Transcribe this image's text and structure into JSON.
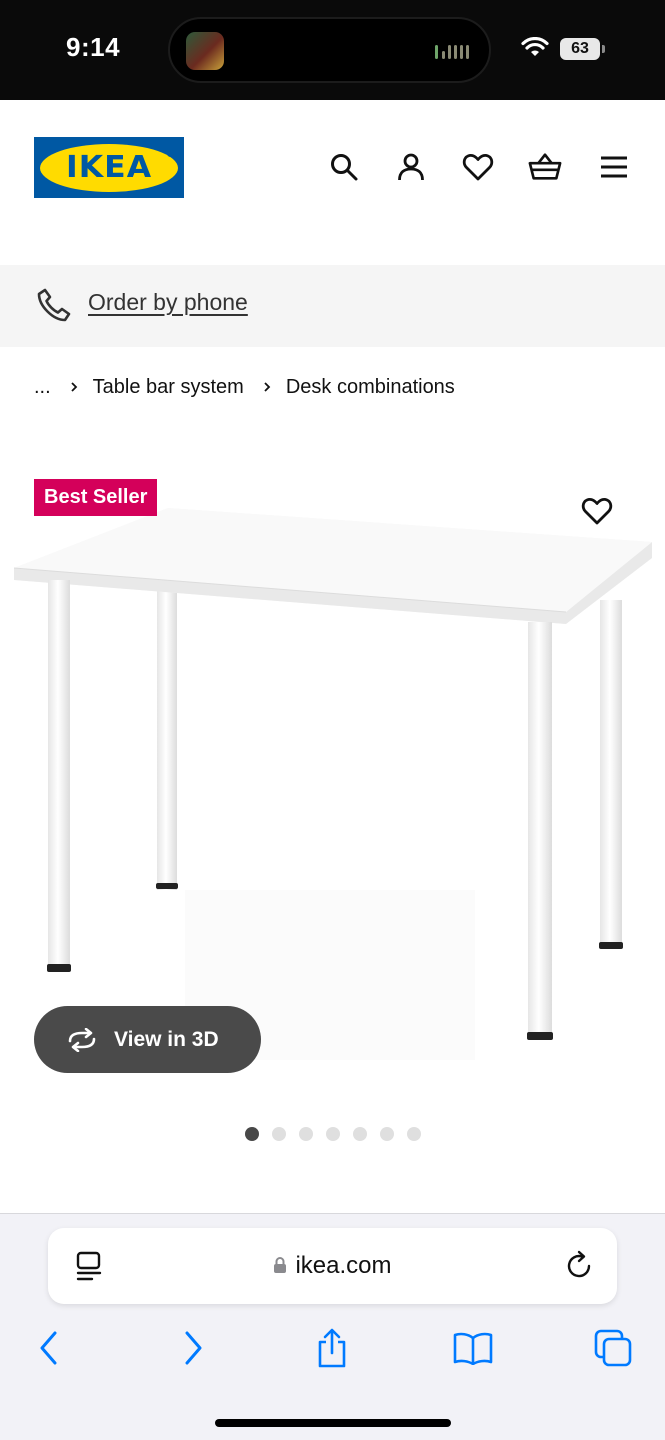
{
  "status_bar": {
    "time": "9:14",
    "battery": "63",
    "icons": [
      "now-playing-art-icon",
      "audio-waveform-icon",
      "wifi-icon",
      "battery-icon"
    ]
  },
  "header": {
    "logo_text": "IKEA",
    "icons": [
      "search-icon",
      "account-icon",
      "favourites-icon",
      "basket-icon",
      "menu-icon"
    ]
  },
  "order_bar": {
    "label": "Order by phone",
    "icon": "phone-icon"
  },
  "breadcrumb": {
    "ellipsis": "...",
    "items": [
      "Table bar system",
      "Desk combinations"
    ]
  },
  "product": {
    "badge": "Best Seller",
    "badge_color": "#d4005a",
    "view_3d_label": "View in 3D",
    "image_count": 7,
    "active_image_index": 0
  },
  "browser": {
    "url": "ikea.com",
    "toolbar": [
      "back-icon",
      "forward-icon",
      "share-icon",
      "bookmarks-icon",
      "tabs-icon"
    ],
    "accent": "#007aff"
  }
}
